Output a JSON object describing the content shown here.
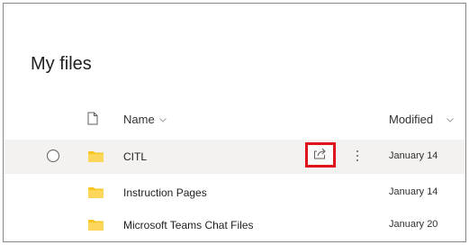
{
  "page": {
    "title": "My files"
  },
  "columns": {
    "name": "Name",
    "modified": "Modified"
  },
  "icons": {
    "file_column": "file-icon",
    "sort": "chevron-down-icon",
    "folder": "folder-icon",
    "share": "share-icon",
    "more": "more-vertical-icon"
  },
  "colors": {
    "folder": "#f8c51c",
    "highlight": "#e0121b"
  },
  "files": [
    {
      "name": "CITL",
      "modified": "January 14",
      "selected": true
    },
    {
      "name": "Instruction Pages",
      "modified": "January 14",
      "selected": false
    },
    {
      "name": "Microsoft Teams Chat Files",
      "modified": "January 20",
      "selected": false
    }
  ]
}
